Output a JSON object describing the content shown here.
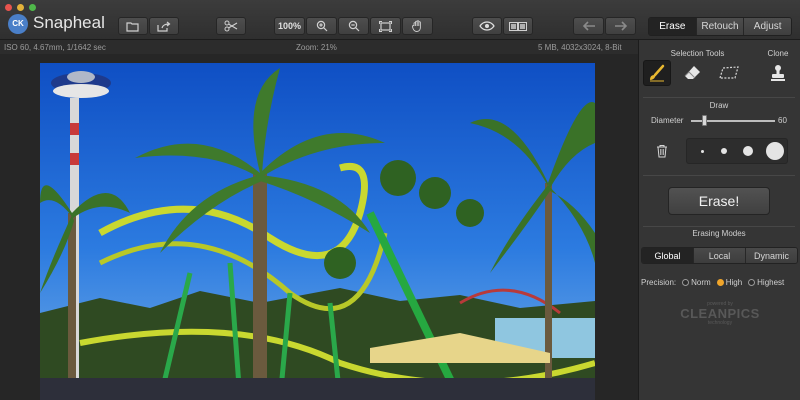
{
  "app": {
    "name": "Snapheal",
    "logo_text": "CK"
  },
  "toolbar": {
    "zoom_value": "100%",
    "mode_tabs": [
      {
        "label": "Erase",
        "active": true
      },
      {
        "label": "Retouch",
        "active": false
      },
      {
        "label": "Adjust",
        "active": false
      }
    ],
    "icons": [
      "open-file-icon",
      "share-icon",
      "crop-scissors-icon",
      "zoom-in-icon",
      "zoom-out-icon",
      "fit-screen-icon",
      "hand-pan-icon",
      "eye-preview-icon",
      "compare-split-icon",
      "undo-arrow-icon",
      "redo-arrow-icon"
    ]
  },
  "infobar": {
    "exif": "ISO 60, 4.67mm, 1/1642 sec",
    "zoom": "Zoom: 21%",
    "file_info": "5 MB, 4032x3024, 8-Bit"
  },
  "panel": {
    "selection_tools_title": "Selection Tools",
    "clone_title": "Clone",
    "draw_title": "Draw",
    "diameter_label": "Diameter",
    "diameter_value": "60",
    "erase_button": "Erase!",
    "erasing_modes_title": "Erasing Modes",
    "erasing_modes": [
      {
        "label": "Global",
        "active": true
      },
      {
        "label": "Local",
        "active": false
      },
      {
        "label": "Dynamic",
        "active": false
      }
    ],
    "precision_label": "Precision:",
    "precision_options": [
      {
        "label": "Norm",
        "selected": false
      },
      {
        "label": "High",
        "selected": true
      },
      {
        "label": "Highest",
        "selected": false
      }
    ],
    "powered_by": "powered by",
    "brand": "CLEANPICS",
    "brand_sub": "technology"
  },
  "colors": {
    "accent_radio": "#f0a52a",
    "brush_active": "#e8b830",
    "toolbar_bg": "#3a3a3a",
    "panel_bg": "#353535"
  }
}
